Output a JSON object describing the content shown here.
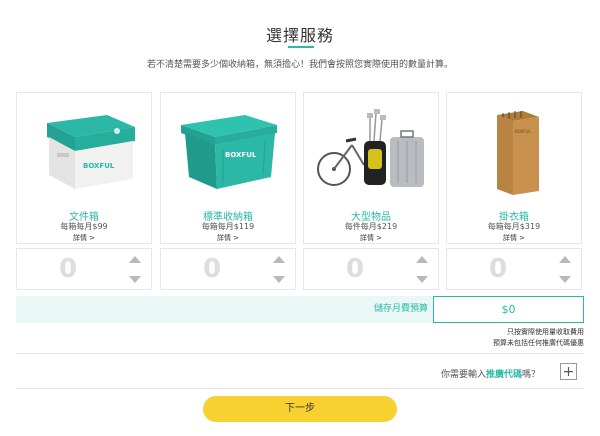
{
  "header": {
    "title": "選擇服務",
    "subtitle": "若不清楚需要多少個收納箱，無須擔心！我們會按照您實際使用的數量計算。"
  },
  "products": [
    {
      "name": "文件箱",
      "price": "每箱每月$99",
      "detail": "詳情 >",
      "quantity": "0",
      "icon": "document-box-icon"
    },
    {
      "name": "標準收納箱",
      "price": "每箱每月$119",
      "detail": "詳情 >",
      "quantity": "0",
      "icon": "storage-bin-icon"
    },
    {
      "name": "大型物品",
      "price": "每件每月$219",
      "detail": "詳情 >",
      "quantity": "0",
      "icon": "bicycle-golf-luggage-icon"
    },
    {
      "name": "掛衣箱",
      "price": "每箱每月$319",
      "detail": "詳情 >",
      "quantity": "0",
      "icon": "wardrobe-box-icon"
    }
  ],
  "box_brand": "BOXFUL",
  "budget": {
    "label": "儲存月費預算",
    "value": "$0",
    "note1": "只按實際使用量收取費用",
    "note2": "預算未包括任何推廣代碼優惠"
  },
  "promo": {
    "prefix": "你需要輸入",
    "highlight": "推廣代碼",
    "suffix": "嗎？",
    "button": "+"
  },
  "next_button": "下一步",
  "colors": {
    "accent": "#2bb8a6",
    "button": "#f7d131",
    "budget_bg": "#e9f8f6"
  }
}
